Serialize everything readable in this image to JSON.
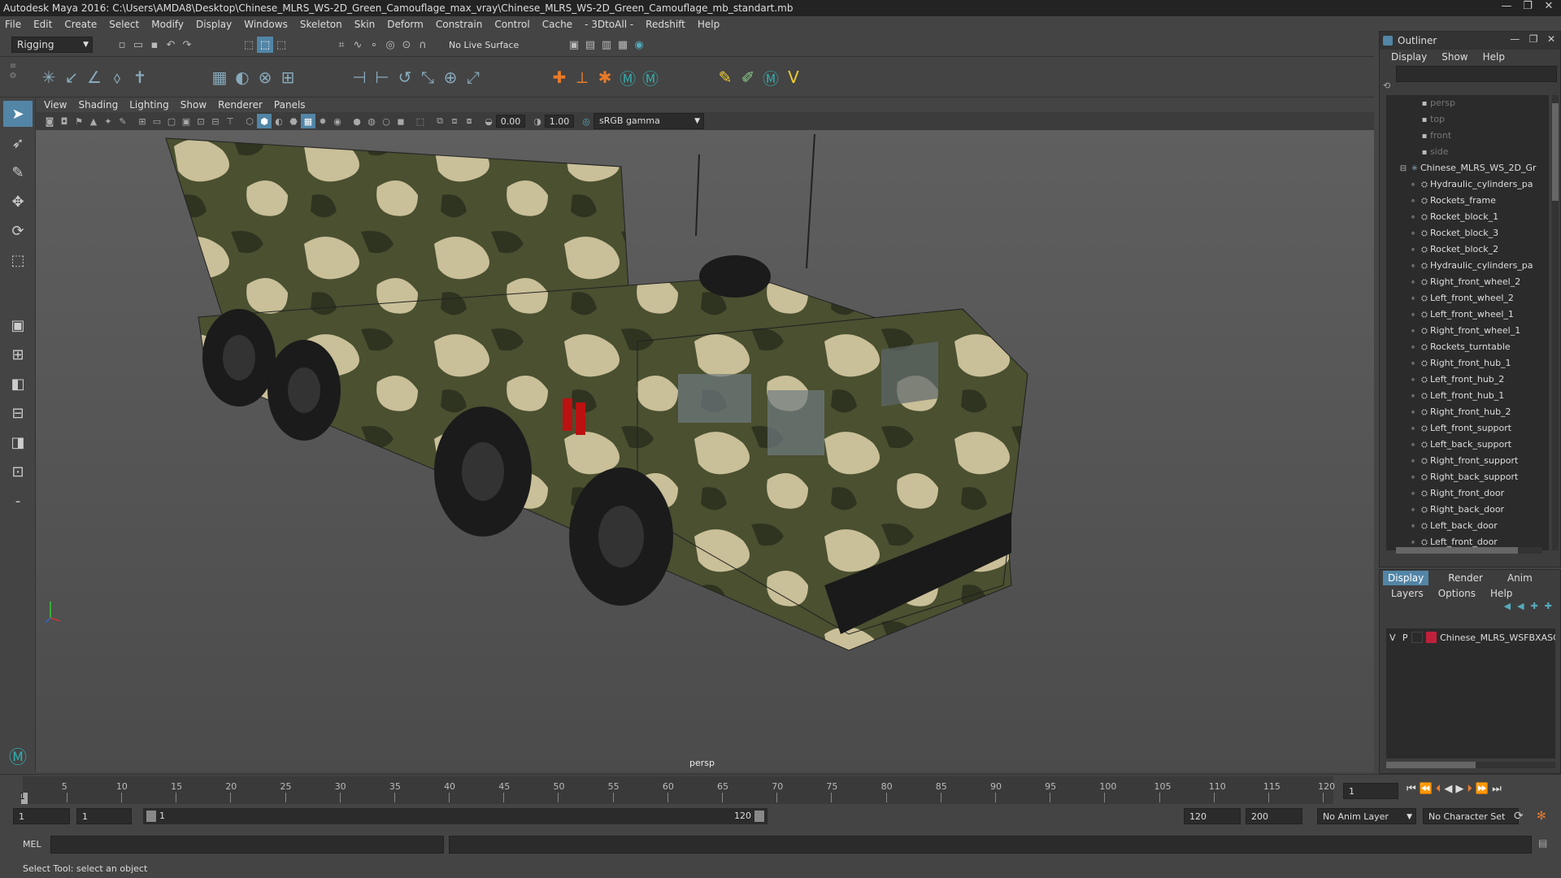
{
  "window": {
    "title": "Autodesk Maya 2016: C:\\Users\\AMDA8\\Desktop\\Chinese_MLRS_WS-2D_Green_Camouflage_max_vray\\Chinese_MLRS_WS-2D_Green_Camouflage_mb_standart.mb",
    "controls": [
      "—",
      "❐",
      "✕"
    ]
  },
  "menubar": [
    "File",
    "Edit",
    "Create",
    "Select",
    "Modify",
    "Display",
    "Windows",
    "Skeleton",
    "Skin",
    "Deform",
    "Constrain",
    "Control",
    "Cache",
    "- 3DtoAll -",
    "Redshift",
    "Help"
  ],
  "shelf": {
    "mode": "Rigging",
    "live_surface": "No Live Surface"
  },
  "panel_menu": [
    "View",
    "Shading",
    "Lighting",
    "Show",
    "Renderer",
    "Panels"
  ],
  "panel_toolbar": {
    "exposure": "0.00",
    "gamma": "1.00",
    "color_space": "sRGB gamma"
  },
  "viewport": {
    "camera_label": "persp"
  },
  "outliner": {
    "title": "Outliner",
    "menu": [
      "Display",
      "Show",
      "Help"
    ],
    "items": [
      {
        "label": "persp",
        "dim": true,
        "indent": 2
      },
      {
        "label": "top",
        "dim": true,
        "indent": 2
      },
      {
        "label": "front",
        "dim": true,
        "indent": 2
      },
      {
        "label": "side",
        "dim": true,
        "indent": 2
      },
      {
        "label": "Chinese_MLRS_WS_2D_Gr",
        "dim": false,
        "indent": 1
      },
      {
        "label": "Hydraulic_cylinders_pa",
        "dim": false,
        "indent": 3
      },
      {
        "label": "Rockets_frame",
        "dim": false,
        "indent": 3
      },
      {
        "label": "Rocket_block_1",
        "dim": false,
        "indent": 3
      },
      {
        "label": "Rocket_block_3",
        "dim": false,
        "indent": 3
      },
      {
        "label": "Rocket_block_2",
        "dim": false,
        "indent": 3
      },
      {
        "label": "Hydraulic_cylinders_pa",
        "dim": false,
        "indent": 3
      },
      {
        "label": "Right_front_wheel_2",
        "dim": false,
        "indent": 3
      },
      {
        "label": "Left_front_wheel_2",
        "dim": false,
        "indent": 3
      },
      {
        "label": "Left_front_wheel_1",
        "dim": false,
        "indent": 3
      },
      {
        "label": "Right_front_wheel_1",
        "dim": false,
        "indent": 3
      },
      {
        "label": "Rockets_turntable",
        "dim": false,
        "indent": 3
      },
      {
        "label": "Right_front_hub_1",
        "dim": false,
        "indent": 3
      },
      {
        "label": "Left_front_hub_2",
        "dim": false,
        "indent": 3
      },
      {
        "label": "Left_front_hub_1",
        "dim": false,
        "indent": 3
      },
      {
        "label": "Right_front_hub_2",
        "dim": false,
        "indent": 3
      },
      {
        "label": "Left_front_support",
        "dim": false,
        "indent": 3
      },
      {
        "label": "Left_back_support",
        "dim": false,
        "indent": 3
      },
      {
        "label": "Right_front_support",
        "dim": false,
        "indent": 3
      },
      {
        "label": "Right_back_support",
        "dim": false,
        "indent": 3
      },
      {
        "label": "Right_front_door",
        "dim": false,
        "indent": 3
      },
      {
        "label": "Right_back_door",
        "dim": false,
        "indent": 3
      },
      {
        "label": "Left_back_door",
        "dim": false,
        "indent": 3
      },
      {
        "label": "Left_front_door",
        "dim": false,
        "indent": 3
      }
    ]
  },
  "layers": {
    "tabs": [
      "Display",
      "Render",
      "Anim"
    ],
    "menu": [
      "Layers",
      "Options",
      "Help"
    ],
    "layer": {
      "v": "V",
      "p": "P",
      "name": "Chinese_MLRS_WSFBXASC",
      "color": "#c0203a"
    }
  },
  "timeline": {
    "ticks": [
      "5",
      "10",
      "15",
      "20",
      "25",
      "30",
      "35",
      "40",
      "45",
      "50",
      "55",
      "60",
      "65",
      "70",
      "75",
      "80",
      "85",
      "90",
      "95",
      "100",
      "105",
      "110",
      "115",
      "120"
    ],
    "start_label": "1",
    "current_frame": "1"
  },
  "range": {
    "start": "1",
    "anim_start": "1",
    "range_start": "1",
    "range_end": "120",
    "end": "120",
    "anim_end": "200",
    "anim_layer": "No Anim Layer",
    "char_set": "No Character Set"
  },
  "mel": {
    "label": "MEL"
  },
  "status": {
    "text": "Select Tool: select an object"
  },
  "colors": {
    "accent": "#5285a6",
    "camo_dark": "#3f4528",
    "camo_light": "#c9bf98"
  }
}
